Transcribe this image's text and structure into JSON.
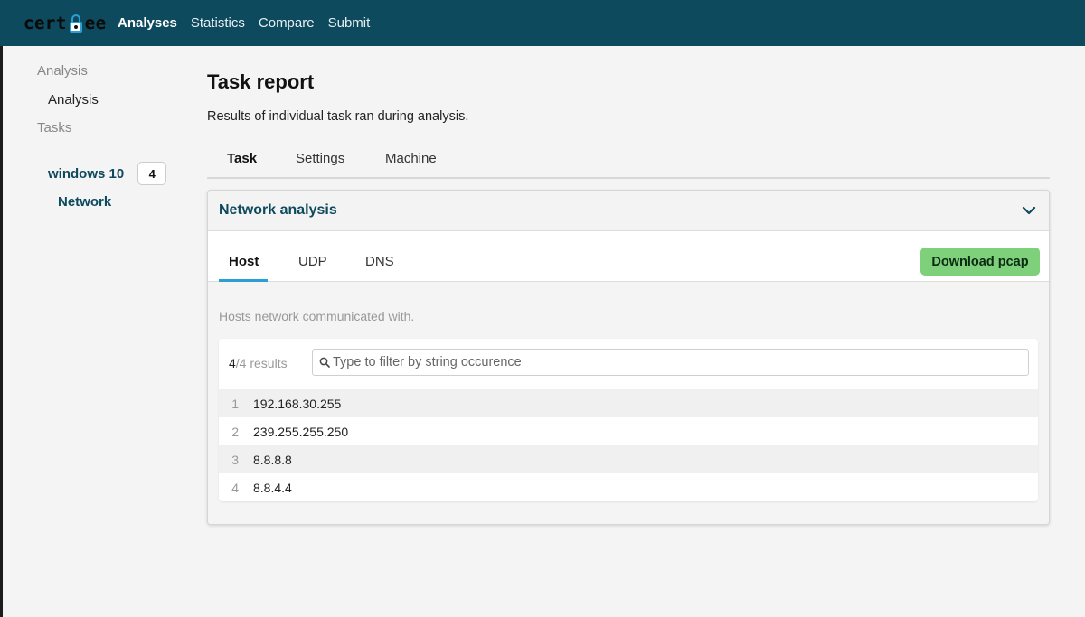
{
  "header": {
    "logo_text": "cert ee",
    "nav": [
      {
        "label": "Analyses",
        "active": true
      },
      {
        "label": "Statistics",
        "active": false
      },
      {
        "label": "Compare",
        "active": false
      },
      {
        "label": "Submit",
        "active": false
      }
    ],
    "background": "#0e4a5e"
  },
  "sidebar": {
    "analysis_heading": "Analysis",
    "analysis_item": "Analysis",
    "tasks_heading": "Tasks",
    "task": {
      "label": "windows 10",
      "count": "4"
    },
    "task_sub": "Network"
  },
  "main": {
    "title": "Task report",
    "description": "Results of individual task ran during analysis.",
    "tabs": [
      {
        "label": "Task",
        "active": true
      },
      {
        "label": "Settings",
        "active": false
      },
      {
        "label": "Machine",
        "active": false
      }
    ]
  },
  "panel": {
    "title": "Network analysis",
    "subtabs": [
      {
        "label": "Host",
        "active": true
      },
      {
        "label": "UDP",
        "active": false
      },
      {
        "label": "DNS",
        "active": false
      }
    ],
    "download_label": "Download pcap",
    "download_color": "#7ed07a",
    "hosts_description": "Hosts network communicated with.",
    "results_shown": "4",
    "results_total_text": "/4 results",
    "filter_placeholder": "Type to filter by string occurence",
    "hosts": [
      {
        "index": "1",
        "value": "192.168.30.255"
      },
      {
        "index": "2",
        "value": "239.255.255.250"
      },
      {
        "index": "3",
        "value": "8.8.8.8"
      },
      {
        "index": "4",
        "value": "8.8.4.4"
      }
    ]
  }
}
